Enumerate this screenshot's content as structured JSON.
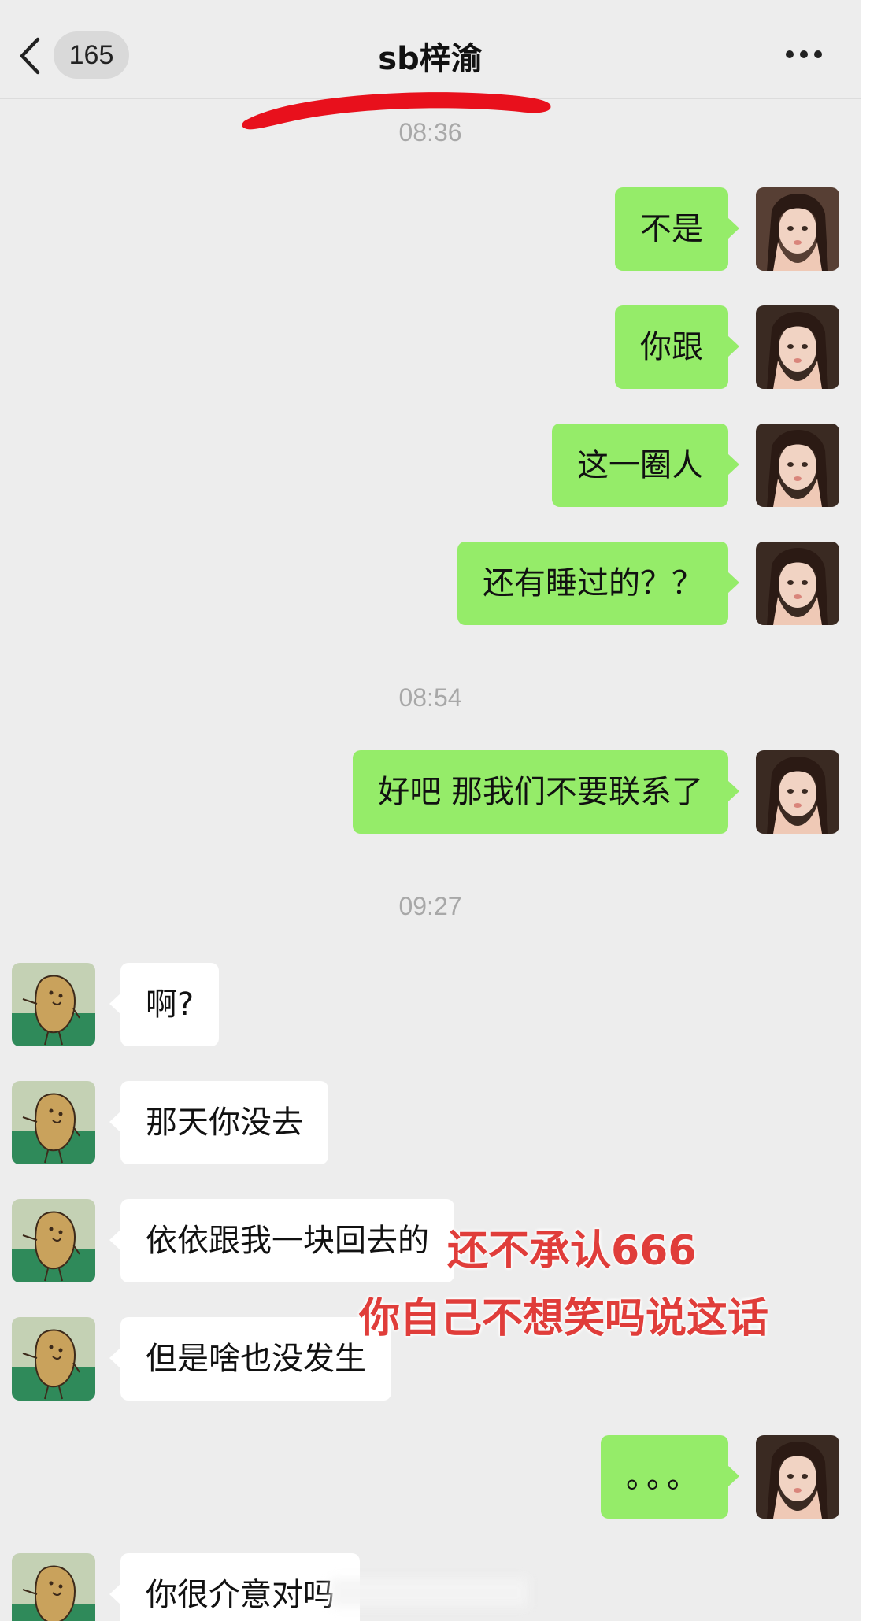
{
  "header": {
    "back_icon": "chevron-left-icon",
    "unread_count": "165",
    "title": "sb梓渝",
    "more_icon": "more-dots-icon"
  },
  "timestamps": [
    "08:36",
    "08:54",
    "09:27"
  ],
  "messages": [
    {
      "side": "me",
      "text": "不是"
    },
    {
      "side": "me",
      "text": "你跟"
    },
    {
      "side": "me",
      "text": "这一圈人"
    },
    {
      "side": "me",
      "text": "还有睡过的？？"
    },
    {
      "side": "me",
      "text": "好吧  那我们不要联系了"
    },
    {
      "side": "other",
      "text": "啊?"
    },
    {
      "side": "other",
      "text": "那天你没去"
    },
    {
      "side": "other",
      "text": "依依跟我一块回去的"
    },
    {
      "side": "other",
      "text": "但是啥也没发生"
    },
    {
      "side": "me",
      "text": "。。。"
    },
    {
      "side": "other",
      "text": "你很介意对吗"
    }
  ],
  "overlay_captions": [
    "还不承认666",
    "你自己不想笑吗说这话"
  ],
  "colors": {
    "outgoing_bubble": "#95ec69",
    "incoming_bubble": "#ffffff",
    "background": "#ededed",
    "caption": "#e03d3a",
    "redaction_mark": "#e8101c"
  }
}
